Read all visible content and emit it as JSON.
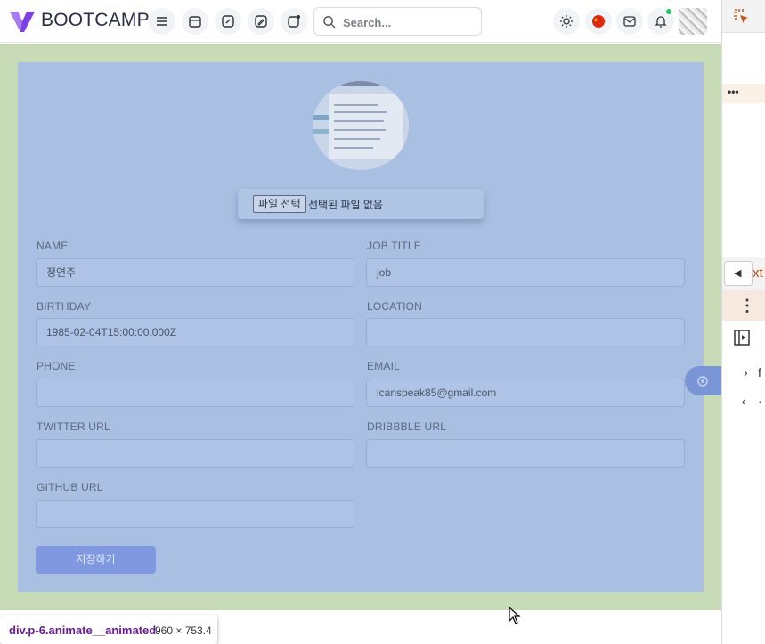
{
  "header": {
    "brand": "BOOTCAMP",
    "search_placeholder": "Search...",
    "buttons": [
      "menu-icon",
      "calendar-icon",
      "edit-icon",
      "pencil-icon",
      "refresh-icon"
    ],
    "right_icons": [
      "sun-icon",
      "flag-icon",
      "mail-icon",
      "bell-icon"
    ]
  },
  "profile": {
    "file_button": "파일 선택",
    "file_status": "선택된 파일 없음"
  },
  "form": {
    "name_label": "NAME",
    "name_value": "정연주",
    "job_title_label": "JOB TITLE",
    "job_title_value": "job",
    "birthday_label": "BIRTHDAY",
    "birthday_value": "1985-02-04T15:00:00.000Z",
    "location_label": "LOCATION",
    "location_value": "",
    "phone_label": "PHONE",
    "phone_value": "",
    "email_label": "EMAIL",
    "email_value": "icanspeak85@gmail.com",
    "twitter_label": "TWITTER URL",
    "twitter_value": "",
    "dribbble_label": "DRIBBBLE URL",
    "dribbble_value": "",
    "github_label": "GITHUB URL",
    "github_value": "",
    "save_label": "저장하기"
  },
  "devtools": {
    "dots": "•••",
    "tab_text": "xt",
    "kebab": "⋮",
    "caret_text": "f",
    "arrow_text": "‹"
  },
  "inspector": {
    "element_name": "div.p-6.animate__animated",
    "dimensions": "960 × 753.4"
  },
  "colors": {
    "padding_highlight": "#c6dbb6",
    "content_highlight": "#aac0e3",
    "save_button": "#7f98e0",
    "brand_purple": "#6f3fd6"
  }
}
